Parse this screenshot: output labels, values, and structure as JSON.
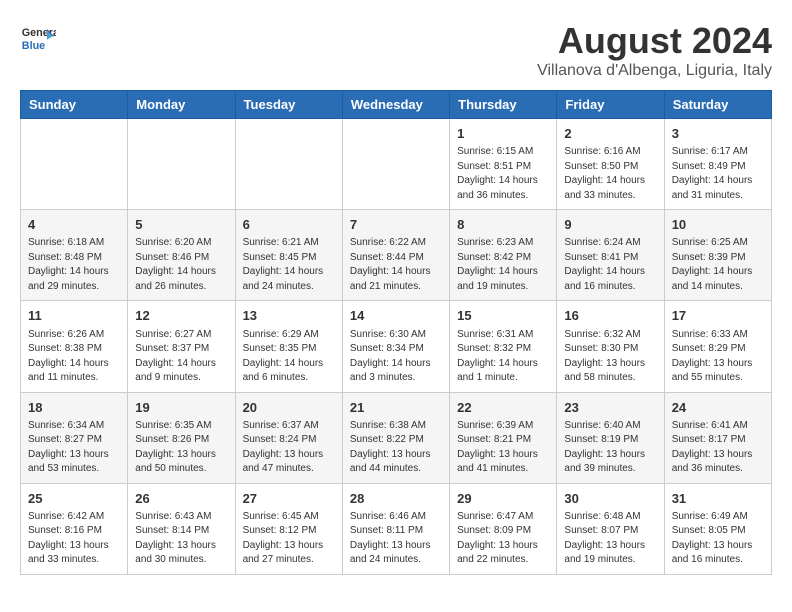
{
  "logo": {
    "name_part1": "General",
    "name_part2": "Blue"
  },
  "header": {
    "title": "August 2024",
    "subtitle": "Villanova d'Albenga, Liguria, Italy"
  },
  "columns": [
    "Sunday",
    "Monday",
    "Tuesday",
    "Wednesday",
    "Thursday",
    "Friday",
    "Saturday"
  ],
  "weeks": [
    [
      {
        "day": "",
        "sunrise": "",
        "sunset": "",
        "daylight": ""
      },
      {
        "day": "",
        "sunrise": "",
        "sunset": "",
        "daylight": ""
      },
      {
        "day": "",
        "sunrise": "",
        "sunset": "",
        "daylight": ""
      },
      {
        "day": "",
        "sunrise": "",
        "sunset": "",
        "daylight": ""
      },
      {
        "day": "1",
        "sunrise": "Sunrise: 6:15 AM",
        "sunset": "Sunset: 8:51 PM",
        "daylight": "Daylight: 14 hours and 36 minutes."
      },
      {
        "day": "2",
        "sunrise": "Sunrise: 6:16 AM",
        "sunset": "Sunset: 8:50 PM",
        "daylight": "Daylight: 14 hours and 33 minutes."
      },
      {
        "day": "3",
        "sunrise": "Sunrise: 6:17 AM",
        "sunset": "Sunset: 8:49 PM",
        "daylight": "Daylight: 14 hours and 31 minutes."
      }
    ],
    [
      {
        "day": "4",
        "sunrise": "Sunrise: 6:18 AM",
        "sunset": "Sunset: 8:48 PM",
        "daylight": "Daylight: 14 hours and 29 minutes."
      },
      {
        "day": "5",
        "sunrise": "Sunrise: 6:20 AM",
        "sunset": "Sunset: 8:46 PM",
        "daylight": "Daylight: 14 hours and 26 minutes."
      },
      {
        "day": "6",
        "sunrise": "Sunrise: 6:21 AM",
        "sunset": "Sunset: 8:45 PM",
        "daylight": "Daylight: 14 hours and 24 minutes."
      },
      {
        "day": "7",
        "sunrise": "Sunrise: 6:22 AM",
        "sunset": "Sunset: 8:44 PM",
        "daylight": "Daylight: 14 hours and 21 minutes."
      },
      {
        "day": "8",
        "sunrise": "Sunrise: 6:23 AM",
        "sunset": "Sunset: 8:42 PM",
        "daylight": "Daylight: 14 hours and 19 minutes."
      },
      {
        "day": "9",
        "sunrise": "Sunrise: 6:24 AM",
        "sunset": "Sunset: 8:41 PM",
        "daylight": "Daylight: 14 hours and 16 minutes."
      },
      {
        "day": "10",
        "sunrise": "Sunrise: 6:25 AM",
        "sunset": "Sunset: 8:39 PM",
        "daylight": "Daylight: 14 hours and 14 minutes."
      }
    ],
    [
      {
        "day": "11",
        "sunrise": "Sunrise: 6:26 AM",
        "sunset": "Sunset: 8:38 PM",
        "daylight": "Daylight: 14 hours and 11 minutes."
      },
      {
        "day": "12",
        "sunrise": "Sunrise: 6:27 AM",
        "sunset": "Sunset: 8:37 PM",
        "daylight": "Daylight: 14 hours and 9 minutes."
      },
      {
        "day": "13",
        "sunrise": "Sunrise: 6:29 AM",
        "sunset": "Sunset: 8:35 PM",
        "daylight": "Daylight: 14 hours and 6 minutes."
      },
      {
        "day": "14",
        "sunrise": "Sunrise: 6:30 AM",
        "sunset": "Sunset: 8:34 PM",
        "daylight": "Daylight: 14 hours and 3 minutes."
      },
      {
        "day": "15",
        "sunrise": "Sunrise: 6:31 AM",
        "sunset": "Sunset: 8:32 PM",
        "daylight": "Daylight: 14 hours and 1 minute."
      },
      {
        "day": "16",
        "sunrise": "Sunrise: 6:32 AM",
        "sunset": "Sunset: 8:30 PM",
        "daylight": "Daylight: 13 hours and 58 minutes."
      },
      {
        "day": "17",
        "sunrise": "Sunrise: 6:33 AM",
        "sunset": "Sunset: 8:29 PM",
        "daylight": "Daylight: 13 hours and 55 minutes."
      }
    ],
    [
      {
        "day": "18",
        "sunrise": "Sunrise: 6:34 AM",
        "sunset": "Sunset: 8:27 PM",
        "daylight": "Daylight: 13 hours and 53 minutes."
      },
      {
        "day": "19",
        "sunrise": "Sunrise: 6:35 AM",
        "sunset": "Sunset: 8:26 PM",
        "daylight": "Daylight: 13 hours and 50 minutes."
      },
      {
        "day": "20",
        "sunrise": "Sunrise: 6:37 AM",
        "sunset": "Sunset: 8:24 PM",
        "daylight": "Daylight: 13 hours and 47 minutes."
      },
      {
        "day": "21",
        "sunrise": "Sunrise: 6:38 AM",
        "sunset": "Sunset: 8:22 PM",
        "daylight": "Daylight: 13 hours and 44 minutes."
      },
      {
        "day": "22",
        "sunrise": "Sunrise: 6:39 AM",
        "sunset": "Sunset: 8:21 PM",
        "daylight": "Daylight: 13 hours and 41 minutes."
      },
      {
        "day": "23",
        "sunrise": "Sunrise: 6:40 AM",
        "sunset": "Sunset: 8:19 PM",
        "daylight": "Daylight: 13 hours and 39 minutes."
      },
      {
        "day": "24",
        "sunrise": "Sunrise: 6:41 AM",
        "sunset": "Sunset: 8:17 PM",
        "daylight": "Daylight: 13 hours and 36 minutes."
      }
    ],
    [
      {
        "day": "25",
        "sunrise": "Sunrise: 6:42 AM",
        "sunset": "Sunset: 8:16 PM",
        "daylight": "Daylight: 13 hours and 33 minutes."
      },
      {
        "day": "26",
        "sunrise": "Sunrise: 6:43 AM",
        "sunset": "Sunset: 8:14 PM",
        "daylight": "Daylight: 13 hours and 30 minutes."
      },
      {
        "day": "27",
        "sunrise": "Sunrise: 6:45 AM",
        "sunset": "Sunset: 8:12 PM",
        "daylight": "Daylight: 13 hours and 27 minutes."
      },
      {
        "day": "28",
        "sunrise": "Sunrise: 6:46 AM",
        "sunset": "Sunset: 8:11 PM",
        "daylight": "Daylight: 13 hours and 24 minutes."
      },
      {
        "day": "29",
        "sunrise": "Sunrise: 6:47 AM",
        "sunset": "Sunset: 8:09 PM",
        "daylight": "Daylight: 13 hours and 22 minutes."
      },
      {
        "day": "30",
        "sunrise": "Sunrise: 6:48 AM",
        "sunset": "Sunset: 8:07 PM",
        "daylight": "Daylight: 13 hours and 19 minutes."
      },
      {
        "day": "31",
        "sunrise": "Sunrise: 6:49 AM",
        "sunset": "Sunset: 8:05 PM",
        "daylight": "Daylight: 13 hours and 16 minutes."
      }
    ]
  ]
}
